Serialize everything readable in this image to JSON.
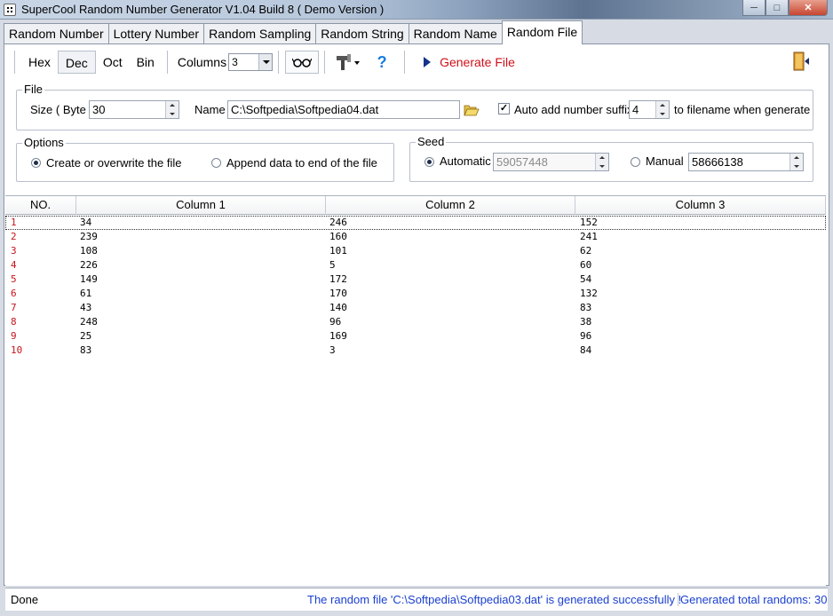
{
  "window": {
    "title": "SuperCool Random Number Generator V1.04 Build 8  ( Demo Version )",
    "min_glyph": "─",
    "max_glyph": "□",
    "close_glyph": "✕"
  },
  "tabs": [
    {
      "label": "Random Number"
    },
    {
      "label": "Lottery Number"
    },
    {
      "label": "Random Sampling"
    },
    {
      "label": "Random String"
    },
    {
      "label": "Random Name"
    },
    {
      "label": "Random File",
      "active": true
    }
  ],
  "toolbar": {
    "hex": "Hex",
    "dec": "Dec",
    "oct": "Oct",
    "bin": "Bin",
    "columns_label": "Columns",
    "columns_value": "3",
    "help_glyph": "?",
    "generate_label": "Generate File",
    "icons": [
      "glasses-icon",
      "tools-icon",
      "help-icon",
      "play-icon",
      "exit-door-icon"
    ]
  },
  "file_group": {
    "title": "File",
    "size_label": "Size ( Byte )",
    "size_value": "30",
    "name_label": "Name",
    "name_value": "C:\\Softpedia\\Softpedia04.dat",
    "auto_suffix_label": "Auto add number suffix",
    "auto_suffix_checked": true,
    "check_glyph": "✓",
    "suffix_value": "4",
    "suffix_tail": "to filename when generate"
  },
  "options_group": {
    "title": "Options",
    "create_label": "Create or overwrite the file",
    "append_label": "Append data to end of the file",
    "selected": "create"
  },
  "seed_group": {
    "title": "Seed",
    "automatic_label": "Automatic",
    "automatic_value": "59057448",
    "manual_label": "Manual",
    "manual_value": "58666138",
    "selected": "automatic"
  },
  "grid": {
    "headers": [
      "NO.",
      "Column 1",
      "Column 2",
      "Column 3"
    ],
    "rows": [
      [
        "1",
        "34",
        "246",
        "152"
      ],
      [
        "2",
        "239",
        "160",
        "241"
      ],
      [
        "3",
        "108",
        "101",
        "62"
      ],
      [
        "4",
        "226",
        "5",
        "60"
      ],
      [
        "5",
        "149",
        "172",
        "54"
      ],
      [
        "6",
        "61",
        "170",
        "132"
      ],
      [
        "7",
        "43",
        "140",
        "83"
      ],
      [
        "8",
        "248",
        "96",
        "38"
      ],
      [
        "9",
        "25",
        "169",
        "96"
      ],
      [
        "10",
        "83",
        "3",
        "84"
      ]
    ]
  },
  "status": {
    "left": "Done",
    "message": "The random file 'C:\\Softpedia\\Softpedia03.dat' is generated successfully !",
    "total": "Generated total randoms: 30"
  },
  "colors": {
    "row_number": "#c8141c",
    "status_text": "#1a3fd0",
    "generate_text": "#d0101a"
  }
}
